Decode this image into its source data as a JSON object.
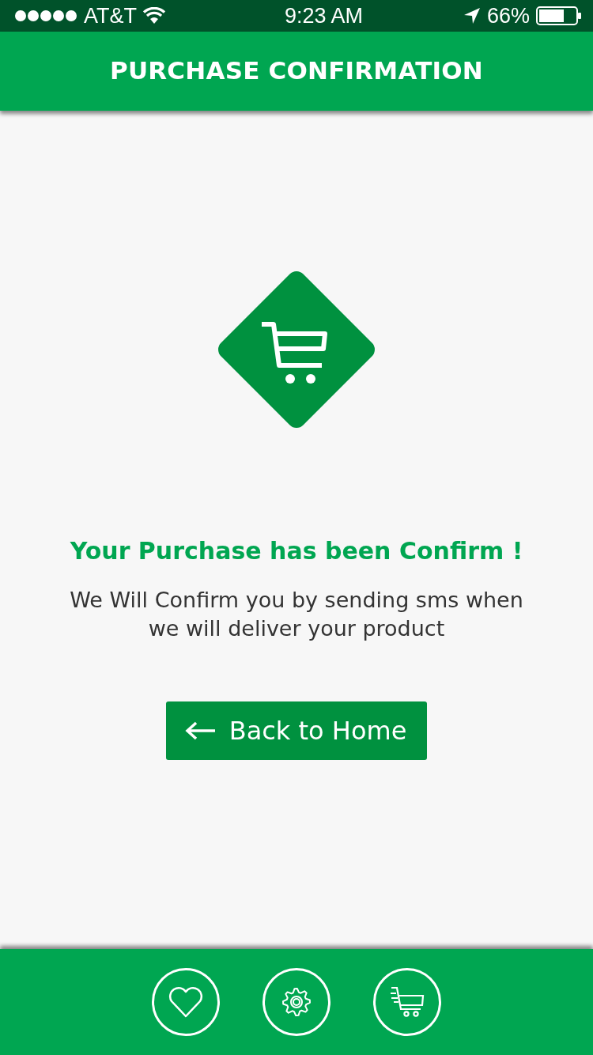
{
  "status_bar": {
    "carrier": "AT&T",
    "time": "9:23 AM",
    "battery": "66%"
  },
  "header": {
    "title": "PURCHASE CONFIRMATION"
  },
  "confirmation": {
    "title": "Your Purchase has been Confirm !",
    "message": "We Will Confirm you by sending sms when we will deliver your product"
  },
  "button": {
    "label": "Back to Home"
  },
  "bottom_nav": [
    {
      "kind": "favorites"
    },
    {
      "kind": "settings"
    },
    {
      "kind": "cart"
    }
  ]
}
